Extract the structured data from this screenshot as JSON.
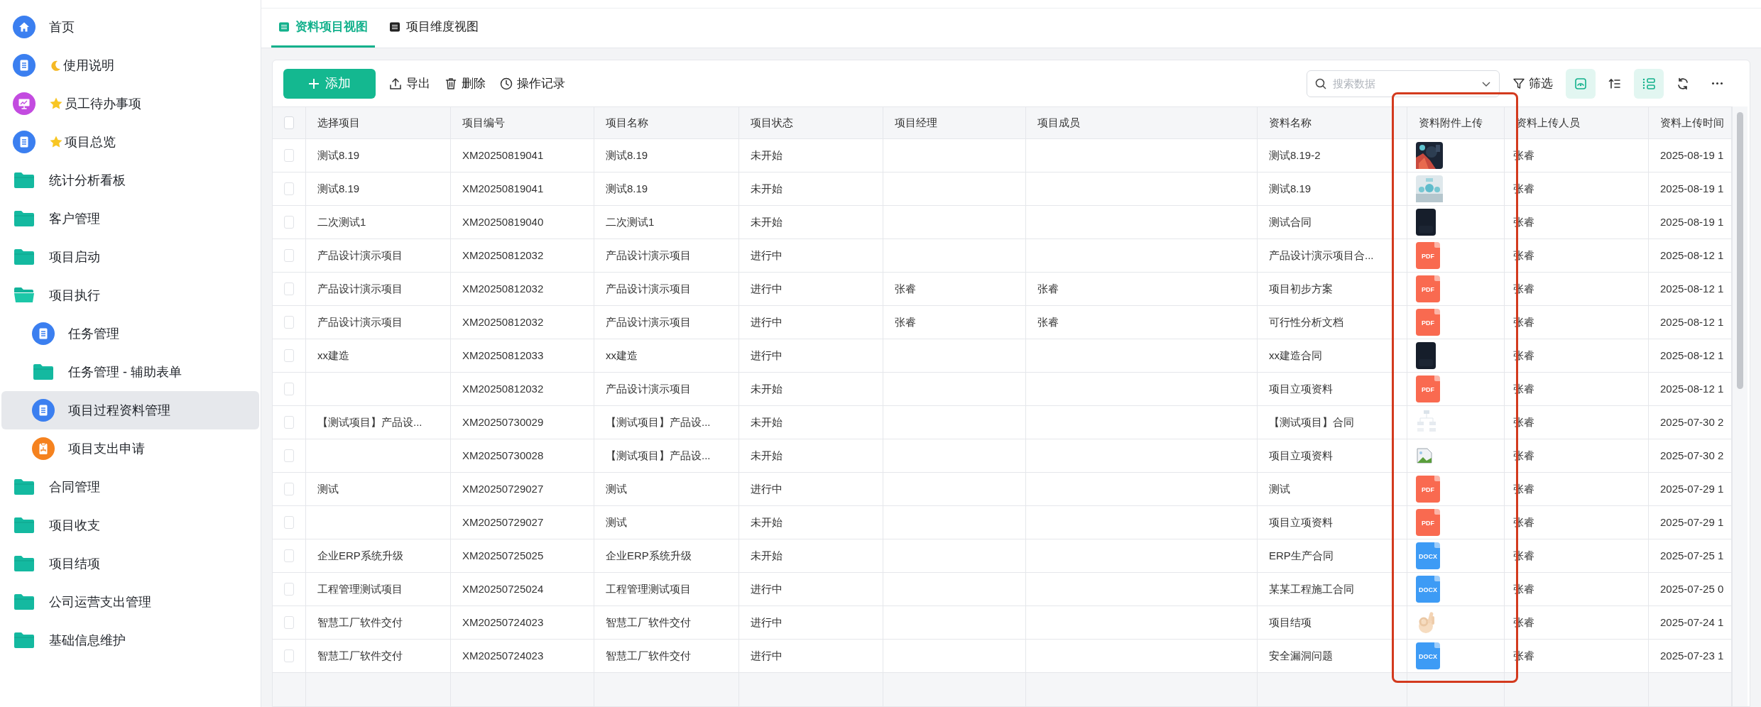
{
  "sidebar": {
    "items": [
      {
        "label": "首页",
        "kind": "home",
        "selected": false
      },
      {
        "label": "使用说明",
        "kind": "doc",
        "prefix": {
          "kind": "moon"
        },
        "selected": false
      },
      {
        "label": "员工待办事项",
        "kind": "monitor",
        "prefix": {
          "kind": "star"
        },
        "selected": false
      },
      {
        "label": "项目总览",
        "kind": "doc",
        "prefix": {
          "kind": "star"
        },
        "selected": false
      },
      {
        "label": "统计分析看板",
        "kind": "folder",
        "selected": false
      },
      {
        "label": "客户管理",
        "kind": "folder",
        "selected": false
      },
      {
        "label": "项目启动",
        "kind": "folder",
        "selected": false
      },
      {
        "label": "项目执行",
        "kind": "folder",
        "expanded": true,
        "selected": false,
        "children": [
          {
            "label": "任务管理",
            "kind": "doc",
            "selected": false
          },
          {
            "label": "任务管理 - 辅助表单",
            "kind": "folder",
            "selected": false
          },
          {
            "label": "项目过程资料管理",
            "kind": "doc",
            "selected": true
          },
          {
            "label": "项目支出申请",
            "kind": "clipboard",
            "selected": false
          }
        ]
      },
      {
        "label": "合同管理",
        "kind": "folder",
        "selected": false
      },
      {
        "label": "项目收支",
        "kind": "folder",
        "selected": false
      },
      {
        "label": "项目结项",
        "kind": "folder",
        "selected": false
      },
      {
        "label": "公司运营支出管理",
        "kind": "folder",
        "selected": false
      },
      {
        "label": "基础信息维护",
        "kind": "folder",
        "selected": false
      }
    ]
  },
  "tabs": [
    {
      "label": "资料项目视图",
      "selected": true
    },
    {
      "label": "项目维度视图",
      "selected": false
    }
  ],
  "toolbar": {
    "add": "添加",
    "actions": [
      {
        "kind": "export",
        "label": "导出"
      },
      {
        "kind": "delete",
        "label": "删除"
      },
      {
        "kind": "history",
        "label": "操作记录"
      }
    ],
    "search": {
      "placeholder": "搜索数据"
    },
    "filter": "筛选",
    "tools": [
      {
        "kind": "view",
        "selected": true
      },
      {
        "kind": "sort",
        "selected": false
      },
      {
        "kind": "layout",
        "selected": true
      },
      {
        "kind": "refresh",
        "selected": false
      },
      {
        "kind": "more",
        "selected": false
      }
    ]
  },
  "table": {
    "header_checked": false,
    "columns": [
      "选择项目",
      "项目编号",
      "项目名称",
      "项目状态",
      "项目经理",
      "项目成员",
      "资料名称",
      "资料附件上传",
      "资料上传人员",
      "资料上传时间"
    ],
    "rows": [
      {
        "checked": false,
        "cells": [
          "测试8.19",
          "XM20250819041",
          "测试8.19",
          "未开始",
          "",
          "",
          "测试8.19-2"
        ],
        "attachment": {
          "kind": "photo_dark"
        },
        "uploader": "张睿",
        "time": "2025-08-19 1"
      },
      {
        "checked": false,
        "cells": [
          "测试8.19",
          "XM20250819041",
          "测试8.19",
          "未开始",
          "",
          "",
          "测试8.19"
        ],
        "attachment": {
          "kind": "photo_light"
        },
        "uploader": "张睿",
        "time": "2025-08-19 1"
      },
      {
        "checked": false,
        "cells": [
          "二次测试1",
          "XM20250819040",
          "二次测试1",
          "未开始",
          "",
          "",
          "测试合同"
        ],
        "attachment": {
          "kind": "dark"
        },
        "uploader": "张睿",
        "time": "2025-08-19 1"
      },
      {
        "checked": false,
        "cells": [
          "产品设计演示项目",
          "XM20250812032",
          "产品设计演示项目",
          "进行中",
          "",
          "",
          "产品设计演示项目合..."
        ],
        "attachment": {
          "kind": "pdf",
          "label": "PDF"
        },
        "uploader": "张睿",
        "time": "2025-08-12 1"
      },
      {
        "checked": false,
        "cells": [
          "产品设计演示项目",
          "XM20250812032",
          "产品设计演示项目",
          "进行中",
          "张睿",
          "张睿",
          "项目初步方案"
        ],
        "attachment": {
          "kind": "pdf",
          "label": "PDF"
        },
        "uploader": "张睿",
        "time": "2025-08-12 1"
      },
      {
        "checked": false,
        "cells": [
          "产品设计演示项目",
          "XM20250812032",
          "产品设计演示项目",
          "进行中",
          "张睿",
          "张睿",
          "可行性分析文档"
        ],
        "attachment": {
          "kind": "pdf",
          "label": "PDF"
        },
        "uploader": "张睿",
        "time": "2025-08-12 1"
      },
      {
        "checked": false,
        "cells": [
          "xx建造",
          "XM20250812033",
          "xx建造",
          "进行中",
          "",
          "",
          "xx建造合同"
        ],
        "attachment": {
          "kind": "dark"
        },
        "uploader": "张睿",
        "time": "2025-08-12 1"
      },
      {
        "checked": false,
        "cells": [
          "",
          "XM20250812032",
          "产品设计演示项目",
          "未开始",
          "",
          "",
          "项目立项资料"
        ],
        "attachment": {
          "kind": "pdf",
          "label": "PDF"
        },
        "uploader": "张睿",
        "time": "2025-08-12 1"
      },
      {
        "checked": false,
        "cells": [
          "【测试项目】产品设...",
          "XM20250730029",
          "【测试项目】产品设...",
          "未开始",
          "",
          "",
          "【测试项目】合同"
        ],
        "attachment": {
          "kind": "diagram"
        },
        "uploader": "张睿",
        "time": "2025-07-30 2"
      },
      {
        "checked": false,
        "cells": [
          "",
          "XM20250730028",
          "【测试项目】产品设...",
          "未开始",
          "",
          "",
          "项目立项资料"
        ],
        "attachment": {
          "kind": "broken"
        },
        "uploader": "张睿",
        "time": "2025-07-30 2"
      },
      {
        "checked": false,
        "cells": [
          "测试",
          "XM20250729027",
          "测试",
          "进行中",
          "",
          "",
          "测试"
        ],
        "attachment": {
          "kind": "pdf",
          "label": "PDF"
        },
        "uploader": "张睿",
        "time": "2025-07-29 1"
      },
      {
        "checked": false,
        "cells": [
          "",
          "XM20250729027",
          "测试",
          "未开始",
          "",
          "",
          "项目立项资料"
        ],
        "attachment": {
          "kind": "pdf",
          "label": "PDF"
        },
        "uploader": "张睿",
        "time": "2025-07-29 1"
      },
      {
        "checked": false,
        "cells": [
          "企业ERP系统升级",
          "XM20250725025",
          "企业ERP系统升级",
          "未开始",
          "",
          "",
          "ERP生产合同"
        ],
        "attachment": {
          "kind": "docx",
          "label": "DOCX"
        },
        "uploader": "张睿",
        "time": "2025-07-25 1"
      },
      {
        "checked": false,
        "cells": [
          "工程管理测试项目",
          "XM20250725024",
          "工程管理测试项目",
          "进行中",
          "",
          "",
          "某某工程施工合同"
        ],
        "attachment": {
          "kind": "docx",
          "label": "DOCX"
        },
        "uploader": "张睿",
        "time": "2025-07-25 0"
      },
      {
        "checked": false,
        "cells": [
          "智慧工厂软件交付",
          "XM20250724023",
          "智慧工厂软件交付",
          "进行中",
          "",
          "",
          "项目结项"
        ],
        "attachment": {
          "kind": "hand"
        },
        "uploader": "张睿",
        "time": "2025-07-24 1"
      },
      {
        "checked": false,
        "cells": [
          "智慧工厂软件交付",
          "XM20250724023",
          "智慧工厂软件交付",
          "进行中",
          "",
          "",
          "安全漏洞问题"
        ],
        "attachment": {
          "kind": "docx",
          "label": "DOCX"
        },
        "uploader": "张睿",
        "time": "2025-07-23 1"
      }
    ]
  }
}
